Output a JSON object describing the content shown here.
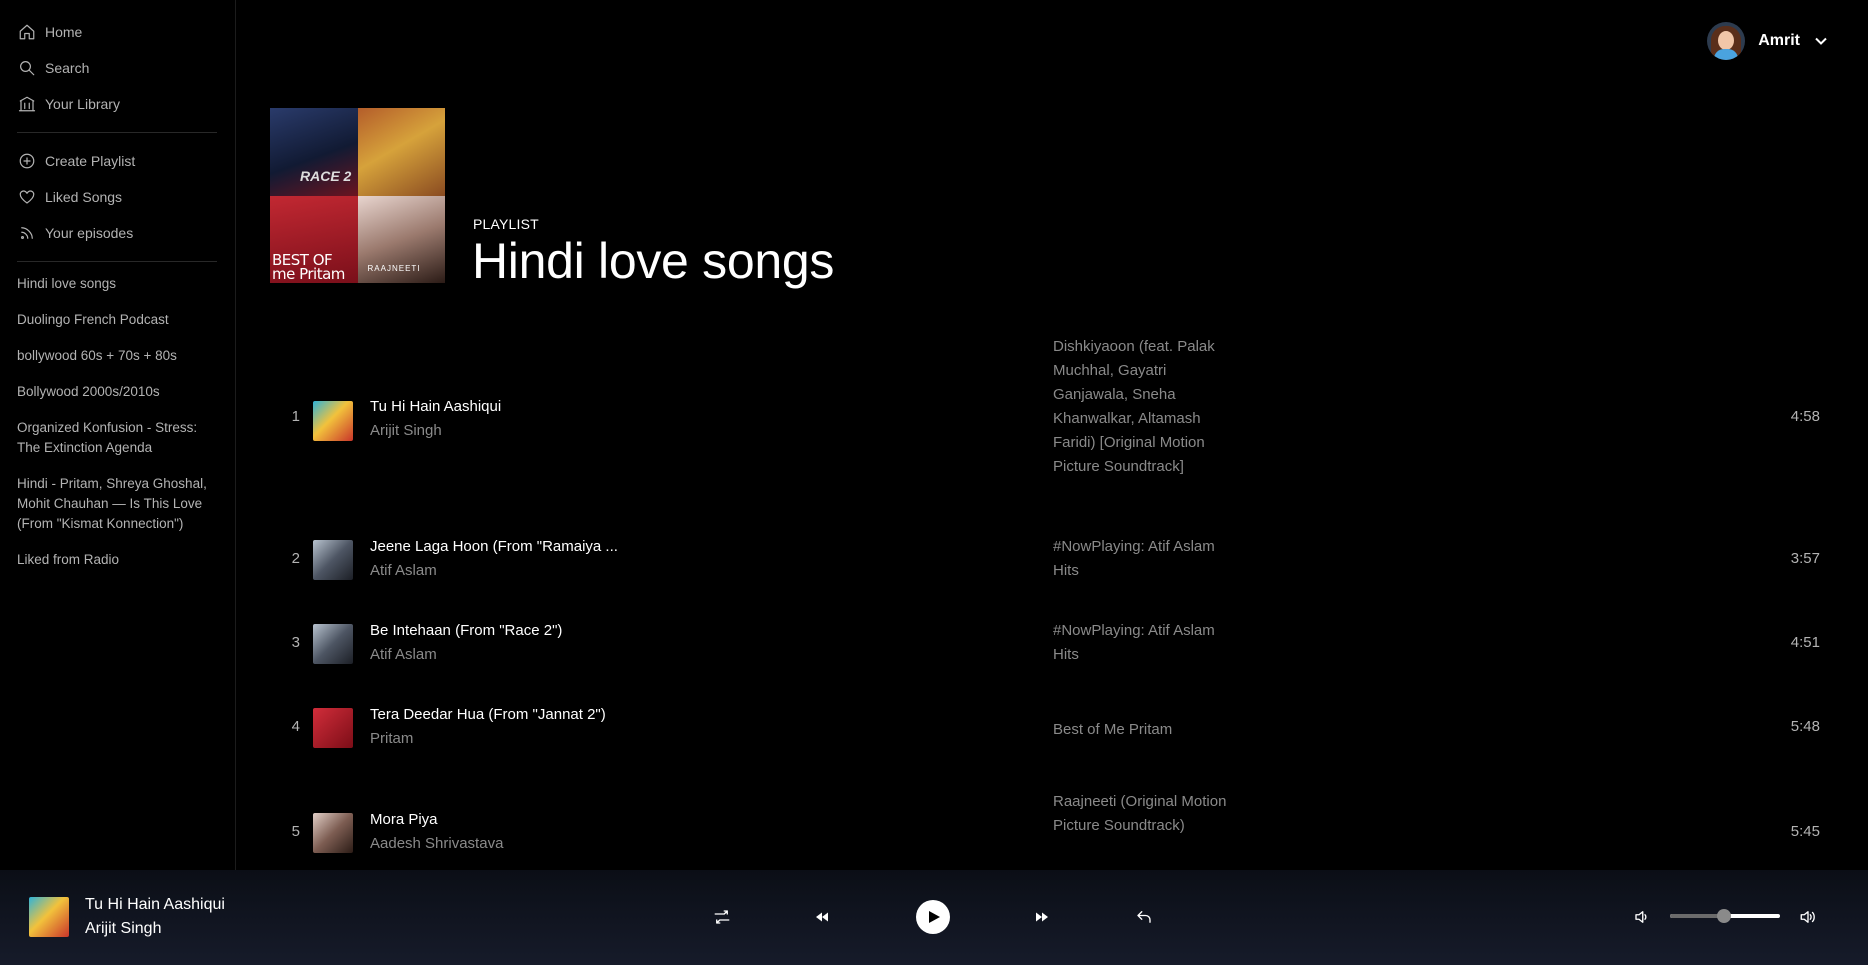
{
  "sidebar": {
    "nav": [
      {
        "label": "Home",
        "icon": "home-icon"
      },
      {
        "label": "Search",
        "icon": "search-icon"
      },
      {
        "label": "Your Library",
        "icon": "library-icon"
      }
    ],
    "actions": [
      {
        "label": "Create Playlist",
        "icon": "plus-circle-icon"
      },
      {
        "label": "Liked Songs",
        "icon": "heart-icon"
      },
      {
        "label": "Your episodes",
        "icon": "rss-icon"
      }
    ],
    "playlists": [
      "Hindi love songs",
      "Duolingo French Podcast",
      "bollywood 60s + 70s + 80s",
      "Bollywood 2000s/2010s",
      "Organized Konfusion - Stress: The Extinction Agenda",
      "Hindi - Pritam, Shreya Ghoshal, Mohit Chauhan — Is This Love (From \"Kismat Konnection\")",
      "Liked from Radio"
    ]
  },
  "user": {
    "name": "Amrit"
  },
  "playlist": {
    "type_label": "PLAYLIST",
    "title": "Hindi love songs",
    "cover_texts": [
      "RACE 2",
      "",
      "BEST OF me Pritam",
      "RAAJNEETI"
    ]
  },
  "tracks": [
    {
      "num": "1",
      "title": "Tu Hi Hain Aashiqui",
      "artist": "Arijit Singh",
      "album": "Dishkiyaoon (feat. Palak Muchhal, Gayatri Ganjawala, Sneha Khanwalkar, Altamash Faridi) [Original Motion Picture Soundtrack]",
      "duration": "4:58"
    },
    {
      "num": "2",
      "title": "Jeene Laga Hoon (From \"Ramaiya ...",
      "artist": "Atif Aslam",
      "album": "#NowPlaying: Atif Aslam Hits",
      "duration": "3:57"
    },
    {
      "num": "3",
      "title": "Be Intehaan (From \"Race 2\")",
      "artist": "Atif Aslam",
      "album": "#NowPlaying: Atif Aslam Hits",
      "duration": "4:51"
    },
    {
      "num": "4",
      "title": "Tera Deedar Hua (From \"Jannat 2\")",
      "artist": "Pritam",
      "album": "Best of Me Pritam",
      "duration": "5:48"
    },
    {
      "num": "5",
      "title": "Mora Piya",
      "artist": "Aadesh Shrivastava",
      "album": "Raajneeti (Original Motion Picture Soundtrack)",
      "duration": "5:45"
    }
  ],
  "player": {
    "now_playing_title": "Tu Hi Hain Aashiqui",
    "now_playing_artist": "Arijit Singh",
    "volume_fraction": 0.5
  }
}
